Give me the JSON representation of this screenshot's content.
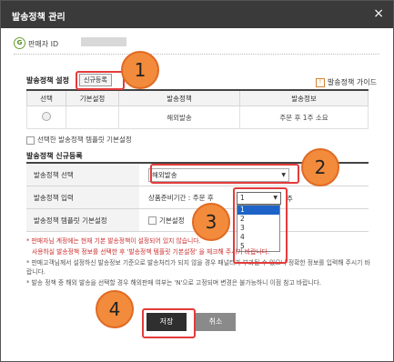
{
  "window": {
    "title": "발송정책 관리",
    "close": "×"
  },
  "seller": {
    "label": "판매자 ID",
    "masked": ""
  },
  "policy_section": {
    "title": "발송정책 설정",
    "register_button": "신규등록",
    "guide": "발송정책 가이드",
    "columns": [
      "선택",
      "기본설정",
      "발송정책",
      "발송정보"
    ],
    "row": {
      "default": "",
      "policy": "해외발송",
      "info": "주문 후 1주 소요"
    }
  },
  "default_checkbox_label": "선택한 발송정책 템플릿 기본설정",
  "new_section": {
    "title": "발송정책 신규등록",
    "rows": [
      {
        "label": "발송정책 선택",
        "value": "해외발송"
      },
      {
        "label": "발송정책 입력",
        "prefix": "상품준비기간 : 주문 후",
        "unit": "주"
      },
      {
        "label": "발송정책 템플릿 기본설정",
        "checkbox": "기본설정"
      }
    ],
    "dropdown_value": "1",
    "dropdown_options": [
      "1",
      "2",
      "3",
      "4",
      "5"
    ]
  },
  "notes": [
    "* 판매자님 계정에는 현재 기본 발송정책이 설정되어 있지 않습니다.",
    "사용하실 발송정책 정보를 선택한 후 '발송정책 템플릿 기본설정' 을 체크해 주시기 바랍니다.",
    "* 판매고객님께서 설정하신 발송정보 기준으로 발송처리가 되지 않을 경우 패널티가 부과될 수 있으니 정확한 정보를 입력해 주시기 바랍니다.",
    "* 발송 정책 중 해외 발송을 선택할 경우 해외판매 여부는 'N'으로 고정되며 변경은 불가능하니 이점 참고 바랍니다."
  ],
  "buttons": {
    "save": "저장",
    "cancel": "취소"
  },
  "annotations": [
    "1",
    "2",
    "3",
    "4"
  ]
}
